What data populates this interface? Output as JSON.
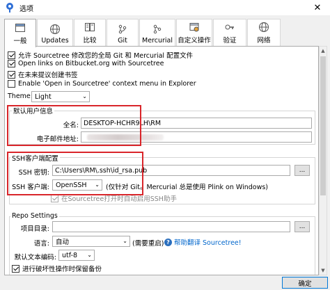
{
  "window": {
    "title": "选项",
    "close": "✕"
  },
  "tabs": [
    {
      "label": "一般",
      "icon": "window-icon"
    },
    {
      "label": "Updates",
      "icon": "globe-icon"
    },
    {
      "label": "比较",
      "icon": "diff-icon"
    },
    {
      "label": "Git",
      "icon": "git-icon"
    },
    {
      "label": "Mercurial",
      "icon": "mercurial-icon"
    },
    {
      "label": "自定义操作",
      "icon": "custom-actions-icon"
    },
    {
      "label": "验证",
      "icon": "key-icon"
    },
    {
      "label": "网络",
      "icon": "globe-icon"
    }
  ],
  "general": {
    "allow_modify": "允许 Sourcetree 修改您的全局 Git 和 Mercurial 配置文件",
    "open_links": "Open links on Bitbucket.org with Sourcetree",
    "future_bookmarks": "在未来提议创建书签",
    "context_menu": "Enable 'Open in Sourcetree' context menu in Explorer",
    "theme_label": "Theme:",
    "theme_value": "Light"
  },
  "user_info": {
    "group_title": "默认用户信息",
    "name_label": "全名:",
    "name_value": "DESKTOP-HCHR9LH\\RM",
    "email_label": "电子邮件地址:"
  },
  "ssh": {
    "group_title": "SSH客户端配置",
    "key_label": "SSH 密钥:",
    "key_value": "C:\\Users\\RM\\.ssh\\id_rsa.pub",
    "browse": "...",
    "client_label": "SSH 客户端:",
    "client_value": "OpenSSH",
    "client_note": "(仅针对 Git。Mercurial 总是使用 Plink on Windows)",
    "auto_start": "在Sourcetree打开时自动启用SSH助手"
  },
  "repo": {
    "group_title": "Repo Settings",
    "project_dir_label": "项目目录:",
    "browse": "...",
    "language_label": "语言:",
    "language_value": "自动",
    "restart_note": "(需要重启)",
    "help_translate": "帮助翻译 Sourcetree!",
    "encoding_label": "默认文本编码:",
    "encoding_value": "utf-8",
    "backup": "进行破坏性操作时保留备份"
  },
  "footer": {
    "ok": "确定"
  }
}
